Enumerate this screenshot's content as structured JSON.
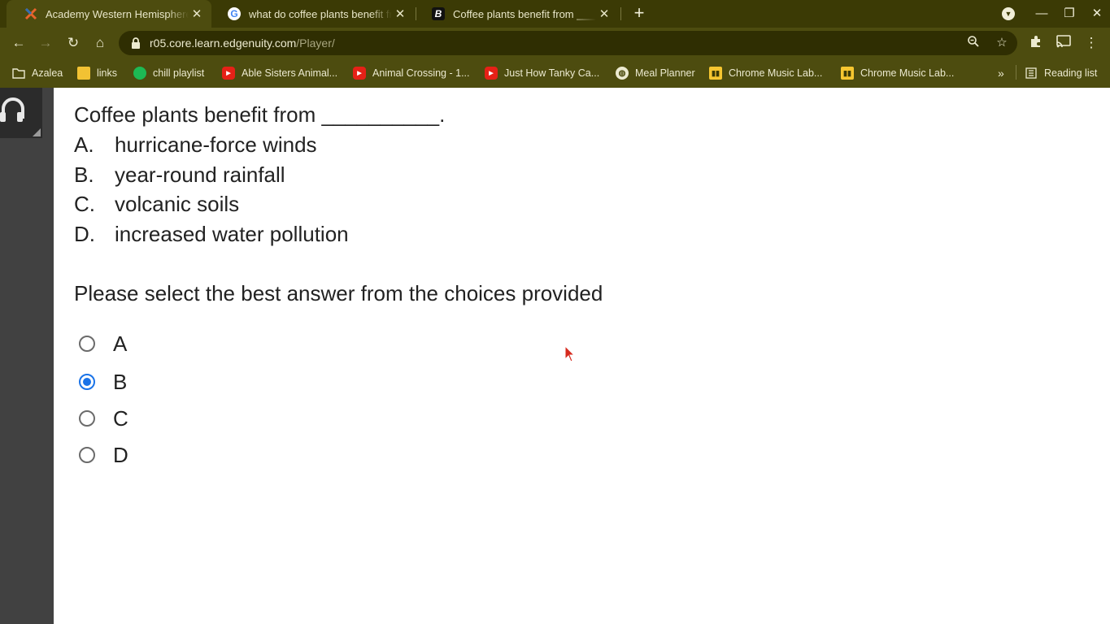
{
  "browser": {
    "tabs": [
      {
        "title": "Academy Western Hemisphere 6",
        "favicon": "edgenuity-x-icon",
        "active": true
      },
      {
        "title": "what do coffee plants benefit from",
        "favicon": "google-g-icon",
        "active": false
      },
      {
        "title": "Coffee plants benefit from ______",
        "favicon": "brainly-b-icon",
        "active": false
      }
    ],
    "new_tab_label": "+",
    "url_host": "r05.core.learn.edgenuity.com",
    "url_path": "/Player/",
    "bookmarks": [
      {
        "label": "Azalea",
        "icon": "folder-icon"
      },
      {
        "label": "links",
        "icon": "folder-icon"
      },
      {
        "label": "chill playlist",
        "icon": "spotify-icon"
      },
      {
        "label": "Able Sisters Animal...",
        "icon": "youtube-icon"
      },
      {
        "label": "Animal Crossing - 1...",
        "icon": "youtube-icon"
      },
      {
        "label": "Just How Tanky Ca...",
        "icon": "youtube-icon"
      },
      {
        "label": "Meal Planner",
        "icon": "globe-icon"
      },
      {
        "label": "Chrome Music Lab...",
        "icon": "music-lab-icon"
      },
      {
        "label": "Chrome Music Lab...",
        "icon": "music-lab-icon"
      }
    ],
    "overflow_label": "»",
    "reading_list_label": "Reading list"
  },
  "quiz": {
    "question": "Coffee plants benefit from __________.",
    "choices": [
      {
        "letter": "A.",
        "text": "hurricane-force winds"
      },
      {
        "letter": "B.",
        "text": "year-round rainfall"
      },
      {
        "letter": "C.",
        "text": "volcanic soils"
      },
      {
        "letter": "D.",
        "text": "increased water pollution"
      }
    ],
    "prompt": "Please select the best answer from the choices provided",
    "options": [
      {
        "label": "A",
        "selected": false
      },
      {
        "label": "B",
        "selected": true
      },
      {
        "label": "C",
        "selected": false
      },
      {
        "label": "D",
        "selected": false
      }
    ]
  },
  "colors": {
    "chrome_dark": "#3b3a05",
    "chrome_toolbar": "#4d4c0f",
    "radio_selected": "#1a73e8"
  }
}
